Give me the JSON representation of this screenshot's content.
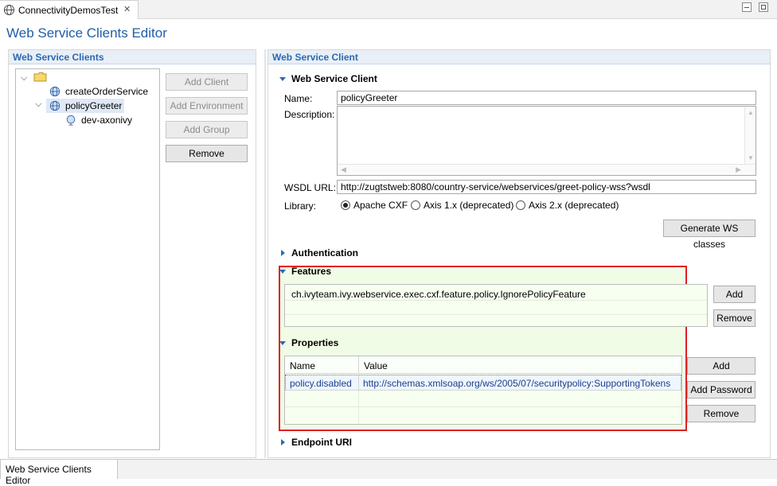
{
  "window": {
    "tab_title": "ConnectivityDemosTest",
    "editor_title": "Web Service Clients Editor",
    "bottom_tab": "Web Service Clients Editor"
  },
  "left": {
    "header": "Web Service Clients",
    "tree": {
      "items": [
        {
          "label": "createOrderService"
        },
        {
          "label": "policyGreeter"
        },
        {
          "label": "dev-axonivy"
        }
      ]
    },
    "buttons": {
      "add_client": "Add Client",
      "add_environment": "Add Environment",
      "add_group": "Add Group",
      "remove": "Remove"
    }
  },
  "right": {
    "header": "Web Service Client",
    "section_client": "Web Service Client",
    "name_label": "Name:",
    "name_value": "policyGreeter",
    "description_label": "Description:",
    "wsdl_label": "WSDL URL:",
    "wsdl_value": "http://zugtstweb:8080/country-service/webservices/greet-policy-wss?wsdl",
    "library_label": "Library:",
    "library_options": [
      "Apache CXF",
      "Axis 1.x (deprecated)",
      "Axis 2.x (deprecated)"
    ],
    "library_selected": "Apache CXF",
    "generate_button": "Generate WS classes",
    "section_auth": "Authentication",
    "section_features": "Features",
    "features": [
      "ch.ivyteam.ivy.webservice.exec.cxf.feature.policy.IgnorePolicyFeature"
    ],
    "features_add": "Add",
    "features_remove": "Remove",
    "section_properties": "Properties",
    "properties_columns": [
      "Name",
      "Value"
    ],
    "properties_rows": [
      {
        "name": "policy.disabled",
        "value": "http://schemas.xmlsoap.org/ws/2005/07/securitypolicy:SupportingTokens"
      }
    ],
    "properties_add": "Add",
    "properties_add_password": "Add Password",
    "properties_remove": "Remove",
    "section_endpoint": "Endpoint URI"
  },
  "colors": {
    "accent": "#1f5ea8",
    "highlight_border": "#e02020",
    "highlight_fill": "#f1fce6"
  }
}
